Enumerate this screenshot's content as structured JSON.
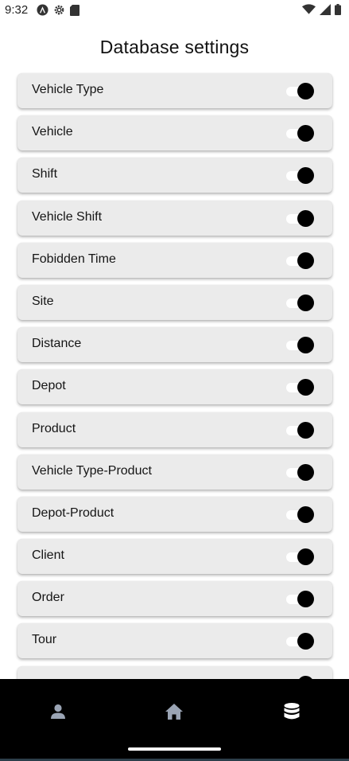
{
  "status_bar": {
    "time": "9:32",
    "left_icons": [
      "android-studio-icon",
      "gear-icon",
      "sd-card-icon"
    ],
    "right_icons": [
      "wifi-icon",
      "signal-icon",
      "battery-icon"
    ]
  },
  "page": {
    "title": "Database settings"
  },
  "settings": [
    {
      "label": "Vehicle Type",
      "enabled": true
    },
    {
      "label": "Vehicle",
      "enabled": true
    },
    {
      "label": "Shift",
      "enabled": true
    },
    {
      "label": "Vehicle Shift",
      "enabled": true
    },
    {
      "label": "Fobidden Time",
      "enabled": true
    },
    {
      "label": "Site",
      "enabled": true
    },
    {
      "label": "Distance",
      "enabled": true
    },
    {
      "label": "Depot",
      "enabled": true
    },
    {
      "label": "Product",
      "enabled": true
    },
    {
      "label": "Vehicle Type-Product",
      "enabled": true
    },
    {
      "label": "Depot-Product",
      "enabled": true
    },
    {
      "label": "Client",
      "enabled": true
    },
    {
      "label": "Order",
      "enabled": true
    },
    {
      "label": "Tour",
      "enabled": true
    }
  ],
  "bottom_nav": {
    "items": [
      {
        "icon": "person-icon",
        "active": false
      },
      {
        "icon": "home-icon",
        "active": false
      },
      {
        "icon": "database-icon",
        "active": true
      }
    ]
  },
  "colors": {
    "card_background": "#ebebeb",
    "toggle_thumb": "#000000",
    "nav_background": "#000000",
    "nav_inactive_icon": "#9aa4b4",
    "nav_active_icon": "#ffffff"
  }
}
